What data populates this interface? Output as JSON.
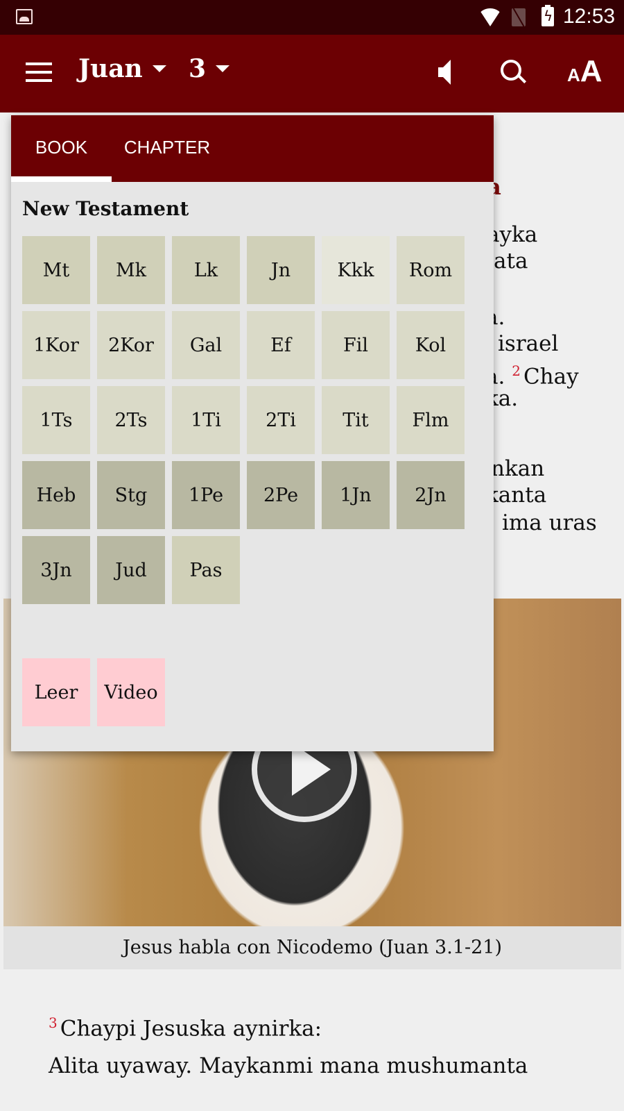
{
  "status_bar": {
    "time": "12:53",
    "icons": [
      "gallery-icon",
      "wifi-icon",
      "no-sim-icon",
      "battery-charging-icon"
    ]
  },
  "app_bar": {
    "book": "Juan",
    "chapter": "3",
    "icons": [
      "menu-icon",
      "audio-icon",
      "search-icon",
      "font-size-icon"
    ],
    "font_size_small": "A",
    "font_size_big": "A"
  },
  "content": {
    "section_heading_visible": "ka",
    "verse_lines": [
      {
        "text": "ayka"
      },
      {
        "text": "ata"
      },
      {
        "text": "a."
      },
      {
        "text": "israel"
      },
      {
        "pre": "a.",
        "verse": "2",
        "text": "Chay"
      },
      {
        "text": "ka."
      },
      {
        "text": "nkan"
      },
      {
        "text": "kanta"
      },
      {
        "text": "ima uras"
      }
    ],
    "video_caption": "Jesus habla con Nicodemo (Juan 3.1-21)",
    "verse3_number": "3",
    "verse3_text": "Chaypi Jesuska aynirka:",
    "para_text": "Alita uyaway. Maykanmi mana mushumanta"
  },
  "book_picker": {
    "tabs": [
      {
        "label": "BOOK",
        "selected": true
      },
      {
        "label": "CHAPTER",
        "selected": false
      }
    ],
    "testament_title": "New Testament",
    "books": [
      {
        "abbr": "Mt",
        "tone": "a"
      },
      {
        "abbr": "Mk",
        "tone": "a"
      },
      {
        "abbr": "Lk",
        "tone": "a"
      },
      {
        "abbr": "Jn",
        "tone": "a"
      },
      {
        "abbr": "Kkk",
        "tone": "b"
      },
      {
        "abbr": "Rom",
        "tone": "c"
      },
      {
        "abbr": "1Kor",
        "tone": "c"
      },
      {
        "abbr": "2Kor",
        "tone": "c"
      },
      {
        "abbr": "Gal",
        "tone": "c"
      },
      {
        "abbr": "Ef",
        "tone": "c"
      },
      {
        "abbr": "Fil",
        "tone": "c"
      },
      {
        "abbr": "Kol",
        "tone": "c"
      },
      {
        "abbr": "1Ts",
        "tone": "c"
      },
      {
        "abbr": "2Ts",
        "tone": "c"
      },
      {
        "abbr": "1Ti",
        "tone": "c"
      },
      {
        "abbr": "2Ti",
        "tone": "c"
      },
      {
        "abbr": "Tit",
        "tone": "c"
      },
      {
        "abbr": "Flm",
        "tone": "c"
      },
      {
        "abbr": "Heb",
        "tone": "d"
      },
      {
        "abbr": "Stg",
        "tone": "d"
      },
      {
        "abbr": "1Pe",
        "tone": "d"
      },
      {
        "abbr": "2Pe",
        "tone": "d"
      },
      {
        "abbr": "1Jn",
        "tone": "d"
      },
      {
        "abbr": "2Jn",
        "tone": "d"
      },
      {
        "abbr": "3Jn",
        "tone": "d"
      },
      {
        "abbr": "Jud",
        "tone": "d"
      },
      {
        "abbr": "Pas",
        "tone": "e"
      }
    ],
    "actions": [
      {
        "label": "Leer"
      },
      {
        "label": "Video"
      }
    ]
  },
  "colors": {
    "status_bar": "#350003",
    "app_bar": "#6c0003",
    "verse_number": "#d02030",
    "heading": "#7a0a0a",
    "action_cell": "#ffccd2"
  }
}
